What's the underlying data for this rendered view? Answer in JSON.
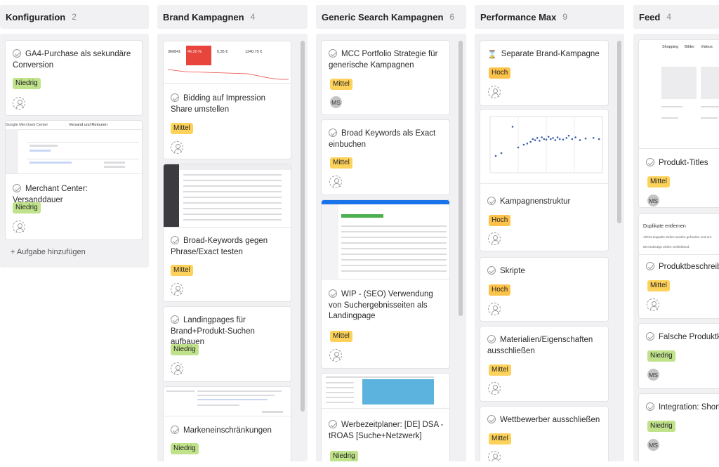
{
  "columns": [
    {
      "title": "Konfiguration",
      "count": "2",
      "add_task": "+ Aufgabe hinzufügen"
    },
    {
      "title": "Brand Kampagnen",
      "count": "4"
    },
    {
      "title": "Generic Search Kampagnen",
      "count": "6"
    },
    {
      "title": "Performance Max",
      "count": "9"
    },
    {
      "title": "Feed",
      "count": "4"
    }
  ],
  "cards": {
    "c1_1": {
      "title": "GA4-Purchase als sekundäre Conversion",
      "priority": "Niedrig"
    },
    "c1_2": {
      "title": "Merchant Center: Versanddauer",
      "priority": "Niedrig",
      "thumb_title": "Google Merchant Center",
      "thumb_tab": "Versand und Retouren"
    },
    "c2_1": {
      "title": "Bidding auf Impression Share umstellen",
      "priority": "Mittel",
      "thumb_stat1": "360841",
      "thumb_stat2": "46.20 %",
      "thumb_stat3": "0,35 €",
      "thumb_stat4": "1340.75 €"
    },
    "c2_2": {
      "title": "Broad-Keywords gegen Phrase/Exact testen",
      "priority": "Mittel"
    },
    "c2_3": {
      "title": "Landingpages für Brand+Produkt-Suchen aufbauen",
      "priority": "Niedrig"
    },
    "c2_4": {
      "title": "Markeneinschränkungen",
      "priority": "Niedrig"
    },
    "c3_1": {
      "title": "MCC Portfolio Strategie für generische Kampagnen",
      "priority": "Mittel",
      "avatar": "MS"
    },
    "c3_2": {
      "title": "Broad Keywords als Exact einbuchen",
      "priority": "Mittel"
    },
    "c3_3": {
      "title": "WIP - (SEO) Verwendung von Suchergebnisseiten als Landingpage",
      "priority": "Mittel"
    },
    "c3_4": {
      "title": "Werbezeitplaner: [DE] DSA - tROAS [Suche+Netzwerk]",
      "priority": "Niedrig"
    },
    "c4_1": {
      "title": "Separate Brand-Kampagne",
      "priority": "Hoch"
    },
    "c4_2": {
      "title": "Kampagnenstruktur",
      "priority": "Hoch"
    },
    "c4_3": {
      "title": "Skripte",
      "priority": "Hoch"
    },
    "c4_4": {
      "title": "Materialien/Eigenschaften ausschließen",
      "priority": "Mittel"
    },
    "c4_5": {
      "title": "Wettbewerber ausschließen",
      "priority": "Mittel"
    },
    "c5_1": {
      "title": "Produkt-Titles",
      "priority": "Mittel",
      "avatar": "MS",
      "thumb_tab1": "Shopping",
      "thumb_tab2": "Bilder",
      "thumb_tab3": "Videos"
    },
    "c5_2": {
      "title": "Produktbeschreibu",
      "priority": "Mittel",
      "thumb_heading": "Duplikate entfernen",
      "thumb_line1": "19753 doppelte Zeilen wurden gefunden und ent",
      "thumb_line2": "88 eindeutige Zeilen verbleibend."
    },
    "c5_3": {
      "title": "Falsche Produktkat",
      "priority": "Niedrig",
      "avatar": "MS"
    },
    "c5_4": {
      "title": "Integration: Short-T",
      "priority": "Niedrig",
      "avatar": "MS"
    }
  },
  "scatter_chart": {
    "chart_data": {
      "type": "scatter",
      "title": "",
      "xlabel": "",
      "ylabel": "",
      "series": [
        {
          "values": [
            [
              0.05,
              0.3
            ],
            [
              0.1,
              0.35
            ],
            [
              0.2,
              0.82
            ],
            [
              0.25,
              0.45
            ],
            [
              0.3,
              0.5
            ],
            [
              0.33,
              0.52
            ],
            [
              0.36,
              0.55
            ],
            [
              0.38,
              0.6
            ],
            [
              0.4,
              0.58
            ],
            [
              0.42,
              0.62
            ],
            [
              0.44,
              0.57
            ],
            [
              0.46,
              0.63
            ],
            [
              0.48,
              0.6
            ],
            [
              0.5,
              0.59
            ],
            [
              0.52,
              0.64
            ],
            [
              0.54,
              0.6
            ],
            [
              0.56,
              0.62
            ],
            [
              0.58,
              0.58
            ],
            [
              0.6,
              0.63
            ],
            [
              0.62,
              0.6
            ],
            [
              0.65,
              0.59
            ],
            [
              0.68,
              0.62
            ],
            [
              0.7,
              0.66
            ],
            [
              0.73,
              0.6
            ],
            [
              0.76,
              0.63
            ],
            [
              0.8,
              0.58
            ],
            [
              0.85,
              0.61
            ],
            [
              0.92,
              0.62
            ],
            [
              0.97,
              0.6
            ]
          ]
        }
      ]
    }
  },
  "colors": {
    "niedrig": "#bfe28b",
    "mittel": "#fdd25b",
    "hoch": "#fdc24a",
    "red_tile": "#e8453c",
    "blue_highlight": "#5bb3de"
  }
}
